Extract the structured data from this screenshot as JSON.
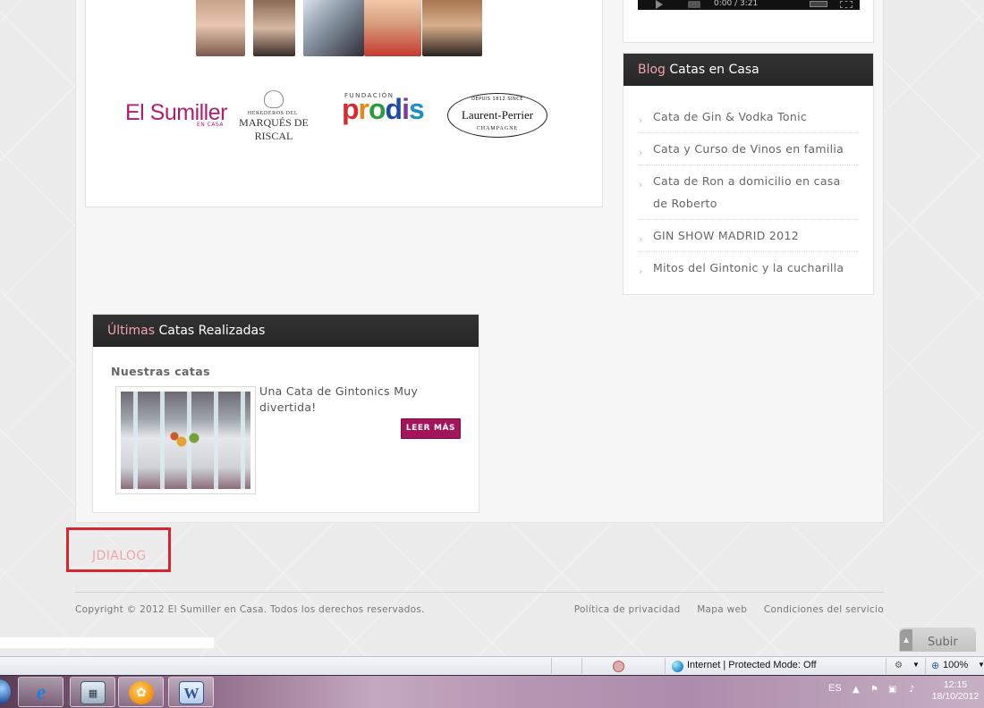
{
  "sponsors": {
    "sumiller": "El Sumiller",
    "sumiller_sub": "EN CASA",
    "marques_top": "HEREDEROS DEL",
    "marques_main": "MARQUÉS DE RISCAL",
    "fundacion": "FUNDACIÓN",
    "prodis_letters": [
      {
        "ch": "p",
        "color": "#d82a32"
      },
      {
        "ch": "r",
        "color": "#e58a1a"
      },
      {
        "ch": "o",
        "color": "#2b9b3c"
      },
      {
        "ch": "d",
        "color": "#1c4d9e"
      },
      {
        "ch": "i",
        "color": "#7d3b99"
      },
      {
        "ch": "s",
        "color": "#1c8fc7"
      }
    ],
    "lp_top": "DEPUIS 1812 SINCE",
    "lp_main": "Laurent-Perrier",
    "lp_sub": "CHAMPAGNE"
  },
  "video": {
    "time": "0:00 / 3:21"
  },
  "blog": {
    "title_accent": "Blog",
    "title_rest": " Catas en Casa",
    "items": [
      "Cata de Gin & Vodka Tonic",
      "Cata y Curso de Vinos en familia",
      "Cata de Ron a domicilio en casa de Roberto",
      "GIN SHOW MADRID 2012",
      "Mitos del Gintonic y la cucharilla"
    ]
  },
  "catas": {
    "title_accent": "Últimas",
    "title_rest": " Catas Realizadas",
    "section": "Nuestras catas",
    "excerpt": " Una Cata de Gintonics Muy divertida!",
    "button": "LEER MÁS"
  },
  "jdialog": {
    "label": "JDIALOG"
  },
  "footer": {
    "copyright": "Copyright © 2012 El Sumiller en Casa. Todos los derechos reservados.",
    "links": [
      "Política de privacidad",
      "Mapa web",
      "Condiciones del servicio"
    ]
  },
  "subir": {
    "label": "Subir"
  },
  "status_bar": {
    "zone": "Internet | Protected Mode: Off",
    "zoom": "100%"
  },
  "taskbar": {
    "lang": "ES",
    "time": "12:15",
    "date": "18/10/2012"
  },
  "colors": {
    "accent_pink": "#f1a4a9",
    "button_magenta": "#a3145a",
    "dialog_red": "#d5262e"
  }
}
